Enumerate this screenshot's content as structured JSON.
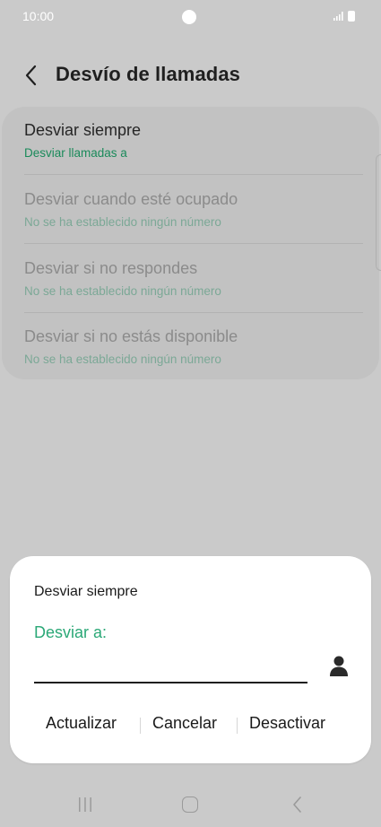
{
  "status_bar": {
    "time": "10:00"
  },
  "header": {
    "title": "Desvío de llamadas"
  },
  "settings": [
    {
      "title": "Desviar siempre",
      "subtitle": "Desviar llamadas a",
      "enabled": true
    },
    {
      "title": "Desviar cuando esté ocupado",
      "subtitle": "No se ha establecido ningún número",
      "enabled": false
    },
    {
      "title": "Desviar si no respondes",
      "subtitle": "No se ha establecido ningún número",
      "enabled": false
    },
    {
      "title": "Desviar si no estás disponible",
      "subtitle": "No se ha establecido ningún número",
      "enabled": false
    }
  ],
  "dialog": {
    "title": "Desviar siempre",
    "field_label": "Desviar a:",
    "field_value": "",
    "buttons": {
      "update": "Actualizar",
      "cancel": "Cancelar",
      "deactivate": "Desactivar"
    }
  },
  "colors": {
    "accent_green": "#2ba877",
    "subtitle_green": "#1a8a5a",
    "background_dim": "#cacaca",
    "dialog_bg": "#ffffff"
  },
  "icons": {
    "back": "back-arrow-icon",
    "contact": "contact-person-icon",
    "nav_recents": "recents-icon",
    "nav_home": "home-icon",
    "nav_back": "nav-back-icon"
  }
}
